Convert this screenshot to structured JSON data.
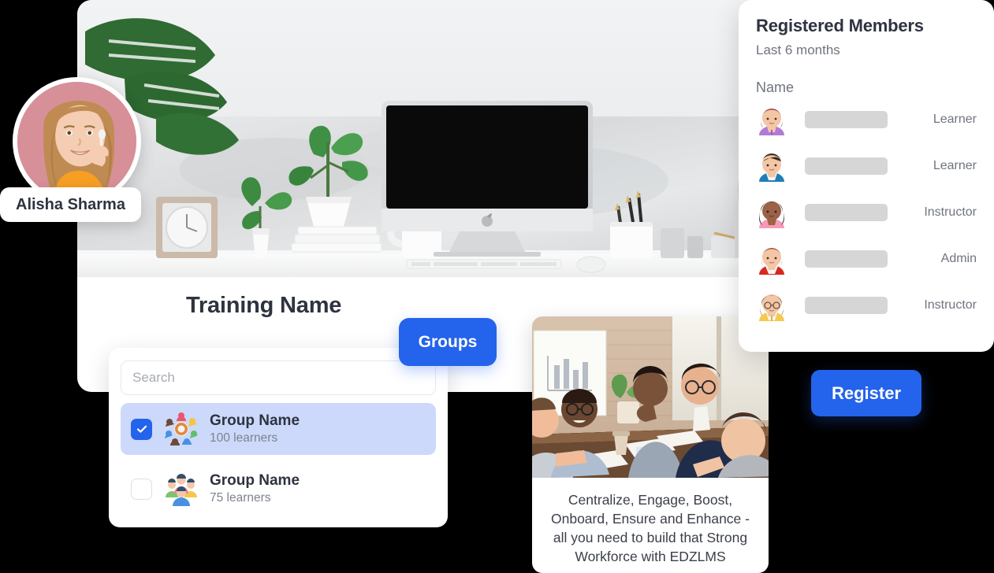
{
  "profile": {
    "name": "Alisha Sharma",
    "avatar_icon": "user-photo-avatar"
  },
  "main_card": {
    "hero_icon": "desk-workspace-photo",
    "training_title": "Training Name"
  },
  "groups_dropdown": {
    "search_placeholder": "Search",
    "search_value": "",
    "items": [
      {
        "name": "Group Name",
        "learners": "100 learners",
        "checked": true,
        "icon": "group-circle-icon"
      },
      {
        "name": "Group Name",
        "learners": "75 learners",
        "checked": false,
        "icon": "group-team-icon"
      }
    ]
  },
  "groups_button": {
    "label": "Groups"
  },
  "register_button": {
    "label": "Register"
  },
  "members_panel": {
    "title": "Registered Members",
    "subtitle": "Last 6 months",
    "column_header": "Name",
    "rows": [
      {
        "role": "Learner",
        "avatar": "avatar-woman-purple"
      },
      {
        "role": "Learner",
        "avatar": "avatar-man-blue"
      },
      {
        "role": "Instructor",
        "avatar": "avatar-woman-pink"
      },
      {
        "role": "Admin",
        "avatar": "avatar-man-red"
      },
      {
        "role": "Instructor",
        "avatar": "avatar-woman-glasses-yellow"
      }
    ]
  },
  "promo_card": {
    "image_icon": "team-meeting-photo",
    "caption": "Centralize, Engage, Boost, Onboard, Ensure and Enhance - all you need to build that Strong Workforce with EDZLMS"
  },
  "colors": {
    "accent_blue": "#2463eb",
    "selected_row": "#ccd9fb",
    "placeholder_bar": "#d6d6d6",
    "text_dark": "#2e3340",
    "text_muted": "#6f747e",
    "card_white": "#ffffff",
    "page_background": "#000000"
  }
}
